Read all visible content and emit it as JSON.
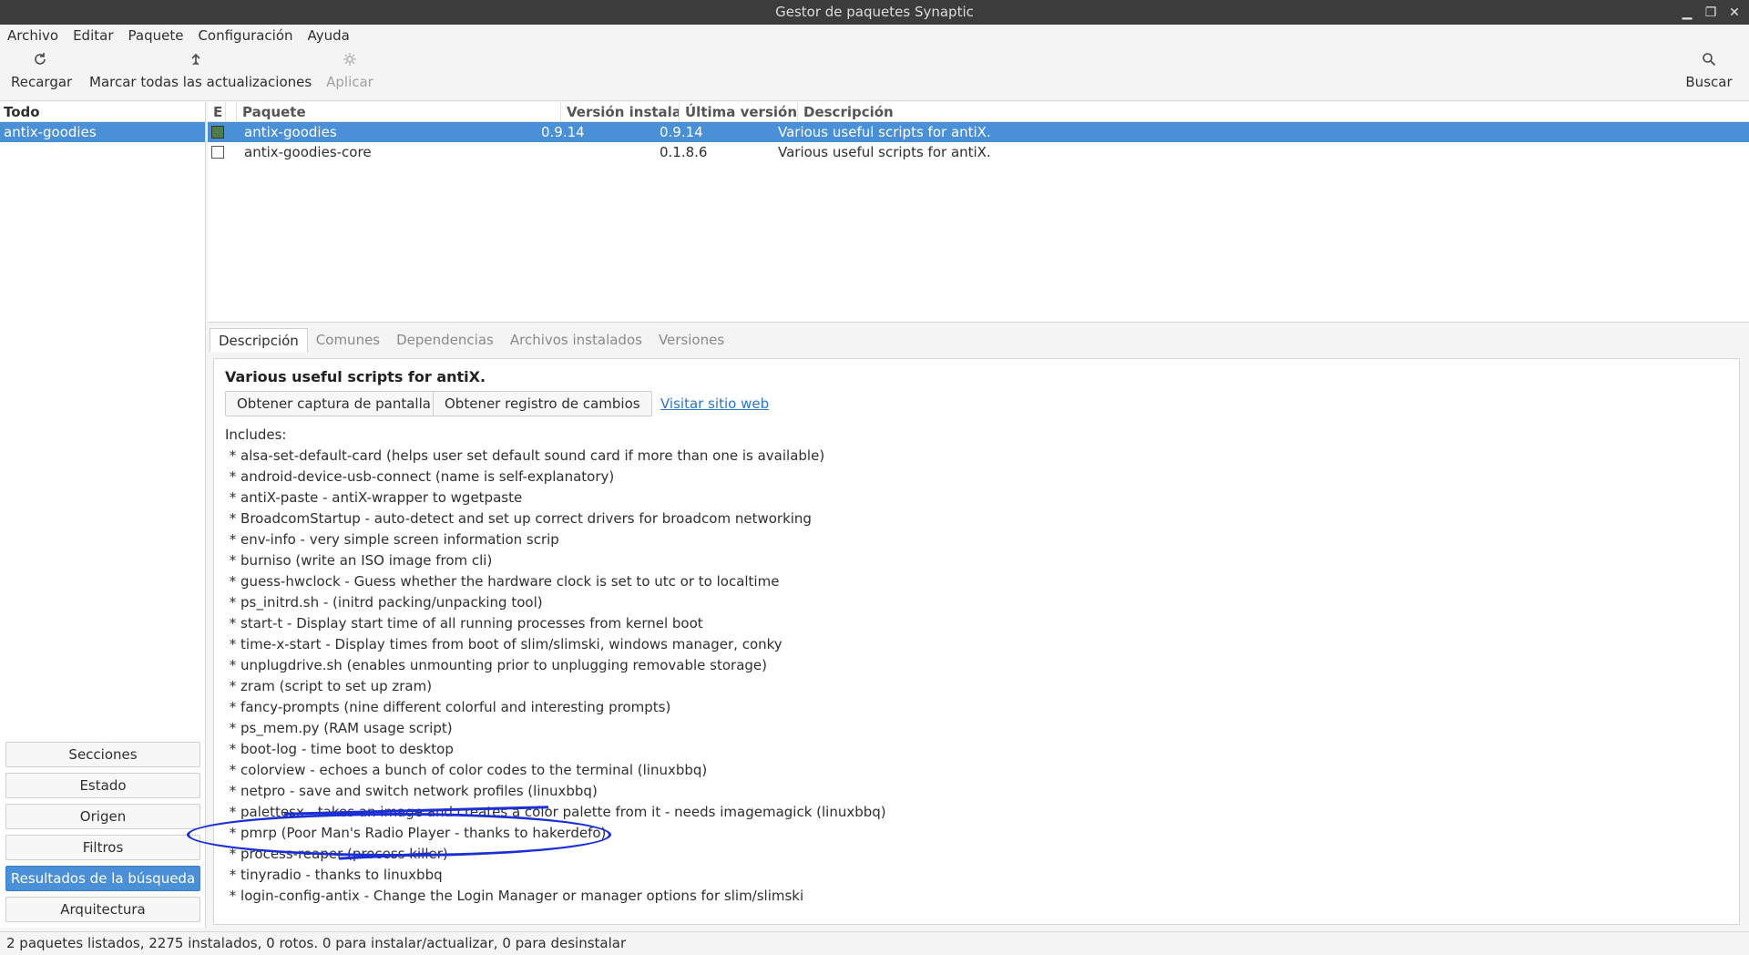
{
  "window": {
    "title": "Gestor de paquetes Synaptic",
    "controls": [
      "▁",
      "❐",
      "✕"
    ]
  },
  "menubar": [
    "Archivo",
    "Editar",
    "Paquete",
    "Configuración",
    "Ayuda"
  ],
  "toolbar": {
    "reload": {
      "label": "Recargar",
      "icon": "reload-icon"
    },
    "mark_all": {
      "label": "Marcar todas las actualizaciones",
      "icon": "upgrade-icon"
    },
    "apply": {
      "label": "Aplicar",
      "icon": "apply-icon"
    },
    "search": {
      "label": "Buscar",
      "icon": "search-icon"
    }
  },
  "leftpanel": {
    "header": "Todo",
    "items": [
      {
        "label": "antix-goodies",
        "selected": true
      }
    ],
    "filters": [
      "Secciones",
      "Estado",
      "Origen",
      "Filtros",
      "Resultados de la búsqueda",
      "Arquitectura"
    ],
    "active_filter": "Resultados de la búsqueda"
  },
  "pkglist": {
    "columns": [
      "E",
      "Paquete",
      "Versión instalad",
      "Última versión",
      "Descripción"
    ],
    "rows": [
      {
        "installed": true,
        "name": "antix-goodies",
        "installed_version": "0.9.14",
        "latest_version": "0.9.14",
        "description": "Various useful scripts for antiX.",
        "selected": true
      },
      {
        "installed": false,
        "name": "antix-goodies-core",
        "installed_version": "",
        "latest_version": "0.1.8.6",
        "description": "Various useful scripts for antiX.",
        "selected": false
      }
    ]
  },
  "details": {
    "tabs": [
      "Descripción",
      "Comunes",
      "Dependencias",
      "Archivos instalados",
      "Versiones"
    ],
    "active_tab": "Descripción",
    "title": "Various useful scripts for antiX.",
    "screenshot_btn": "Obtener captura de pantalla",
    "changelog_btn": "Obtener registro de cambios",
    "website_link": "Visitar sitio web",
    "lines": [
      "Includes:",
      " * alsa-set-default-card (helps user set default sound card if more than one is available)",
      " * android-device-usb-connect (name is self-explanatory)",
      " * antiX-paste - antiX-wrapper to wgetpaste",
      " * BroadcomStartup - auto-detect and set up correct drivers for broadcom networking",
      " * env-info - very simple screen information scrip",
      " * burniso (write an ISO image from cli)",
      " * guess-hwclock - Guess whether the hardware clock is set to utc or to localtime",
      " * ps_initrd.sh - (initrd packing/unpacking tool)",
      " * start-t - Display start time of all running processes from kernel boot",
      " * time-x-start - Display times from boot of slim/slimski, windows manager, conky",
      " * unplugdrive.sh (enables unmounting prior to unplugging removable storage)",
      " * zram (script to set up zram)",
      " * fancy-prompts (nine different colorful and interesting prompts)",
      " * ps_mem.py (RAM usage script)",
      " * boot-log - time boot to desktop",
      " * colorview - echoes a bunch of color codes to the terminal (linuxbbq)",
      " * netpro - save and switch network profiles (linuxbbq)",
      " * palettesx - takes an image and creates a color palette from it - needs imagemagick (linuxbbq)",
      " * pmrp (Poor Man's Radio Player - thanks to hakerdefo)",
      " * process-reaper (process killer)",
      " * tinyradio - thanks to linuxbbq",
      " * login-config-antix - Change the Login Manager or manager options for slim/slimski"
    ]
  },
  "statusbar": "2 paquetes listados, 2275 instalados, 0 rotos. 0 para instalar/actualizar, 0 para desinstalar",
  "colors": {
    "accent": "#4a90d9",
    "annotation": "#1a2fd6"
  }
}
